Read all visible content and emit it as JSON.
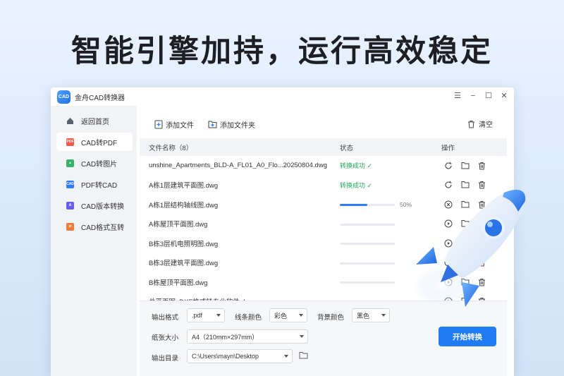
{
  "headline": "智能引擎加持，运行高效稳定",
  "window": {
    "logo_text": "CAD",
    "title": "金舟CAD转换器"
  },
  "controls": {
    "menu": "☰",
    "minimize": "−",
    "maximize": "☐",
    "close": "✕"
  },
  "sidebar": {
    "items": [
      {
        "label": "返回首页",
        "icon": "home-icon",
        "color": "#5a6270"
      },
      {
        "label": "CAD转PDF",
        "icon": "pdf-icon",
        "color": "#f15a4a",
        "active": true
      },
      {
        "label": "CAD转图片",
        "icon": "image-icon",
        "color": "#37b36b"
      },
      {
        "label": "PDF转CAD",
        "icon": "cad-icon",
        "color": "#2f7cf6"
      },
      {
        "label": "CAD版本转换",
        "icon": "version-icon",
        "color": "#6b5cf0"
      },
      {
        "label": "CAD格式互转",
        "icon": "format-icon",
        "color": "#f07a3a"
      }
    ]
  },
  "toolbar": {
    "add_file": "添加文件",
    "add_folder": "添加文件夹",
    "clear": "清空"
  },
  "table": {
    "headers": {
      "name": "文件名称（8）",
      "status": "状态",
      "ops": "操作"
    },
    "rows": [
      {
        "name": "unshine_Apartments_BLD-A_FL01_A0_Flo...20250804.dwg",
        "status": "转换成功 ✓",
        "state": "done"
      },
      {
        "name": "A栋1层建筑平面图.dwg",
        "status": "转换成功 ✓",
        "state": "done"
      },
      {
        "name": "A栋1层结构轴线图.dwg",
        "progress": 0.5,
        "progress_label": "50%",
        "state": "running"
      },
      {
        "name": "A栋屋顶平面图.dwg",
        "progress": 0,
        "state": "waiting"
      },
      {
        "name": "B栋3层机电照明图.dwg",
        "progress": 0,
        "state": "waiting"
      },
      {
        "name": "B栋3层建筑平面图.dwg",
        "progress": 0,
        "state": "waiting"
      },
      {
        "name": "B栋屋顶平面图.dwg",
        "progress": 0,
        "state": "waiting"
      },
      {
        "name": "总平面图_DXF格式转专业软件.dwg",
        "progress": 0,
        "state": "waiting"
      }
    ]
  },
  "settings": {
    "format_label": "输出格式",
    "format_value": ".pdf",
    "line_color_label": "线条颜色",
    "line_color_value": "彩色",
    "bg_color_label": "背景颜色",
    "bg_color_value": "黑色",
    "paper_label": "纸张大小",
    "paper_value": "A4（210mm×297mm）",
    "output_label": "输出目录",
    "output_value": "C:\\Users\\mayn\\Desktop",
    "start_button": "开始转换"
  }
}
